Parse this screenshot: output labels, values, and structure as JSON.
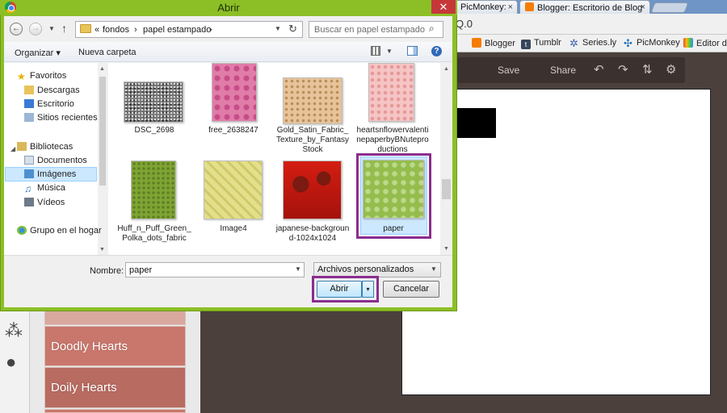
{
  "browser": {
    "tabs": [
      {
        "label": "PicMonkey:",
        "close": "×"
      },
      {
        "label": "Blogger: Escritorio de Blog",
        "close": "×"
      }
    ],
    "address_fragment": "Q.0",
    "bookmarks": [
      "Blogger",
      "Tumblr",
      "Series.ly",
      "PicMonkey",
      "Editor de"
    ],
    "picmonkey": {
      "toolbar": {
        "save": "Save",
        "share": "Share"
      },
      "overlay_items": [
        "Doodly Hearts",
        "Doily Hearts"
      ]
    }
  },
  "dialog": {
    "title": "Abrir",
    "close_glyph": "✕",
    "path": {
      "overflow": "«",
      "segments": [
        "fondos",
        "papel estampado"
      ],
      "separator": "›"
    },
    "search_placeholder": "Buscar en papel estampado",
    "commands": {
      "organize": "Organizar ▾",
      "new_folder": "Nueva carpeta"
    },
    "nav_pane": {
      "favorites_header": "Favoritos",
      "favorites": [
        "Descargas",
        "Escritorio",
        "Sitios recientes"
      ],
      "libraries_header": "Bibliotecas",
      "libraries": [
        "Documentos",
        "Imágenes",
        "Música",
        "Vídeos"
      ],
      "selected": "Imágenes",
      "homegroup": "Grupo en el hogar"
    },
    "files": [
      {
        "name": "DSC_2698"
      },
      {
        "name": "free_2638247"
      },
      {
        "name": "Gold_Satin_Fabric_Texture_by_FantasyStock"
      },
      {
        "name": "heartsnflowervalentinepaperbyBNuteproductions"
      },
      {
        "name": "Huff_n_Puff_Green_Polka_dots_fabric"
      },
      {
        "name": "Image4"
      },
      {
        "name": "japanese-background-1024x1024"
      },
      {
        "name": "paper",
        "selected": true
      }
    ],
    "file_name_label": "Nombre:",
    "file_name_value": "paper",
    "file_type_value": "Archivos personalizados",
    "buttons": {
      "open": "Abrir",
      "open_split": "▾",
      "cancel": "Cancelar"
    },
    "highlight_color": "#8b2d8f",
    "titlebar_color": "#8cbf26"
  }
}
